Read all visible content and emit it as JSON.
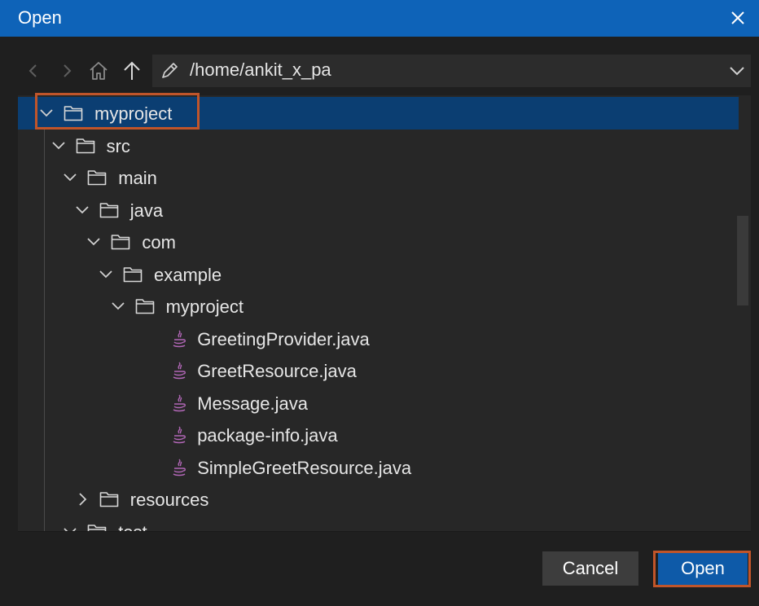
{
  "dialog": {
    "title": "Open",
    "path": "/home/ankit_x_pa"
  },
  "tree": {
    "items": [
      {
        "label": "myproject",
        "type": "folder",
        "expanded": true,
        "selected": true
      },
      {
        "label": "src",
        "type": "folder",
        "expanded": true
      },
      {
        "label": "main",
        "type": "folder",
        "expanded": true
      },
      {
        "label": "java",
        "type": "folder",
        "expanded": true
      },
      {
        "label": "com",
        "type": "folder",
        "expanded": true
      },
      {
        "label": "example",
        "type": "folder",
        "expanded": true
      },
      {
        "label": "myproject",
        "type": "folder",
        "expanded": true
      },
      {
        "label": "GreetingProvider.java",
        "type": "java-file"
      },
      {
        "label": "GreetResource.java",
        "type": "java-file"
      },
      {
        "label": "Message.java",
        "type": "java-file"
      },
      {
        "label": "package-info.java",
        "type": "java-file"
      },
      {
        "label": "SimpleGreetResource.java",
        "type": "java-file"
      },
      {
        "label": "resources",
        "type": "folder",
        "expanded": false
      },
      {
        "label": "test",
        "type": "folder",
        "expanded": true
      }
    ]
  },
  "buttons": {
    "cancel": "Cancel",
    "open": "Open"
  },
  "colors": {
    "titlebar": "#0e63b8",
    "selection": "#0b3e72",
    "highlight_outline": "#c0552a",
    "java_icon": "#b267b7"
  },
  "icons": {
    "back": "chevron-left-icon",
    "forward": "chevron-right-icon",
    "home": "home-icon",
    "up": "arrow-up-icon",
    "edit": "pencil-icon",
    "dropdown": "chevron-down-icon",
    "folder": "folder-icon",
    "java": "java-file-icon",
    "close": "close-icon"
  }
}
